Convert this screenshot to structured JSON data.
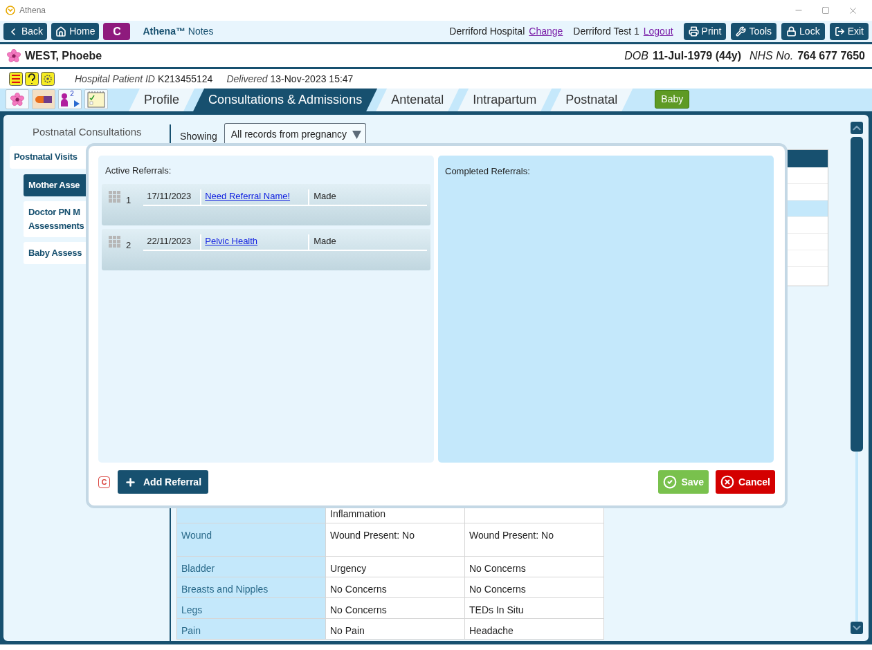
{
  "window": {
    "title": "Athena"
  },
  "toolbar": {
    "nav": [
      {
        "label": "Back",
        "kind": "back"
      },
      {
        "label": "Home",
        "kind": "home"
      }
    ],
    "c_badge": "C",
    "app_title": "**Athena™** Notes",
    "location": "Derriford Hospital",
    "location_link": "Change",
    "user": "Derriford Test 1",
    "user_link": "Logout",
    "actions": [
      {
        "label": "Print",
        "kind": "print"
      },
      {
        "label": "Tools",
        "kind": "tools"
      },
      {
        "label": "Lock",
        "kind": "lock"
      },
      {
        "label": "Exit",
        "kind": "exit"
      }
    ]
  },
  "patient": {
    "name": "WEST, Phoebe",
    "dob_label": "DOB",
    "dob": "11-Jul-1979 (44y)",
    "nhs_label": "NHS No.",
    "nhs": "764 677 7650"
  },
  "info": {
    "id_label": "Hospital Patient ID",
    "id": "K213455124",
    "delivered_label": "Delivered",
    "delivered": "13-Nov-2023 15:47"
  },
  "shortcut_count": "2",
  "tabs": [
    {
      "label": "Profile",
      "selected": false
    },
    {
      "label": "Consultations & Admissions",
      "selected": true
    },
    {
      "label": "Antenatal",
      "selected": false
    },
    {
      "label": "Intrapartum",
      "selected": false
    },
    {
      "label": "Postnatal",
      "selected": false
    }
  ],
  "baby_button": "Baby",
  "sidebar": {
    "title": "Postnatal Consultations",
    "tab": "Postnatal Visits",
    "items": [
      {
        "lines": [
          "Mother Asse"
        ],
        "selected": true
      },
      {
        "lines": [
          "Doctor PN M",
          "Assessments"
        ],
        "selected": false
      },
      {
        "lines": [
          "Baby Assess"
        ],
        "selected": false
      }
    ]
  },
  "filter": {
    "label": "Showing",
    "value": "All records from pregnancy"
  },
  "table": {
    "rows": [
      [
        "",
        "Inflammation",
        ""
      ],
      [
        "Wound",
        "Wound Present: No",
        "Wound Present: No"
      ],
      [
        "Bladder",
        "Urgency",
        "No Concerns"
      ],
      [
        "Breasts and Nipples",
        "No Concerns",
        "No Concerns"
      ],
      [
        "Legs",
        "No Concerns",
        "TEDs In Situ"
      ],
      [
        "Pain",
        "No Pain",
        "Headache"
      ]
    ]
  },
  "modal": {
    "active_title": "Active Referrals:",
    "referrals": [
      {
        "number": "1",
        "date": "17/11/2023",
        "name": "Need Referral Name!",
        "status": "Made"
      },
      {
        "number": "2",
        "date": "22/11/2023",
        "name": "Pelvic Health",
        "status": "Made"
      }
    ],
    "completed_title": "Completed Referrals:",
    "c_mark": "C",
    "add_button": "Add Referral",
    "save_button": "Save",
    "cancel_button": "Cancel"
  }
}
